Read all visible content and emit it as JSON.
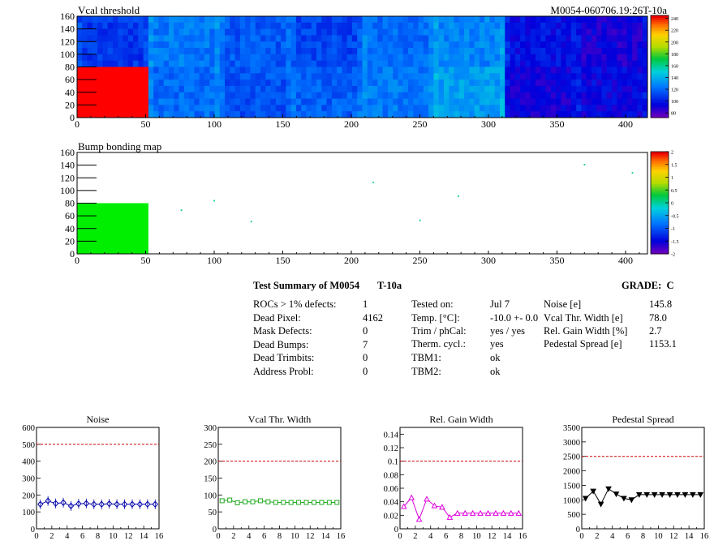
{
  "header": {
    "right_title": "M0054-060706.19:26T-10a"
  },
  "maps": [
    {
      "title": "Vcal threshold",
      "xticks": [
        0,
        50,
        100,
        150,
        200,
        250,
        300,
        350,
        400
      ],
      "yticks": [
        0,
        20,
        40,
        60,
        80,
        100,
        120,
        140,
        160
      ],
      "xlim": [
        0,
        416
      ],
      "ylim": [
        0,
        160
      ],
      "palette_labels": [
        "240",
        "220",
        "200",
        "180",
        "160",
        "140",
        "120",
        "100",
        "80"
      ],
      "palette_min": 72,
      "palette_max": 245,
      "dead_block": {
        "x": [
          0,
          52
        ],
        "y": [
          0,
          80
        ],
        "color": "#ff0000"
      }
    },
    {
      "title": "Bump bonding map",
      "xticks": [
        0,
        50,
        100,
        150,
        200,
        250,
        300,
        350,
        400
      ],
      "yticks": [
        0,
        20,
        40,
        60,
        80,
        100,
        120,
        140,
        160
      ],
      "xlim": [
        0,
        416
      ],
      "ylim": [
        0,
        160
      ],
      "palette_labels": [
        "2",
        "1.5",
        "1",
        "0.5",
        "0",
        "-0.5",
        "-1",
        "-1.5",
        "-2"
      ],
      "palette_min": -2,
      "palette_max": 2,
      "dead_block": {
        "x": [
          0,
          52
        ],
        "y": [
          0,
          80
        ],
        "color": "#00ee00"
      },
      "points": [
        [
          76,
          69
        ],
        [
          100,
          84
        ],
        [
          127,
          51
        ],
        [
          216,
          113
        ],
        [
          250,
          53
        ],
        [
          278,
          91
        ],
        [
          370,
          141
        ],
        [
          405,
          128
        ]
      ]
    }
  ],
  "summary": {
    "title": "Test Summary of M0054",
    "subtitle": "T-10a",
    "grade": "GRADE:  C",
    "col1": [
      [
        "ROCs > 1% defects:",
        "1"
      ],
      [
        "Dead Pixel:",
        "4162"
      ],
      [
        "Mask Defects:",
        "0"
      ],
      [
        "Dead Bumps:",
        "7"
      ],
      [
        "Dead Trimbits:",
        "0"
      ],
      [
        "Address Probl:",
        "0"
      ]
    ],
    "col2": [
      [
        "Tested on:",
        "Jul 7"
      ],
      [
        "Temp. [°C]:",
        "-10.0 +- 0.0"
      ],
      [
        "Trim / phCal:",
        "yes / yes"
      ],
      [
        "Therm. cycl.:",
        "yes"
      ],
      [
        "TBM1:",
        "ok"
      ],
      [
        "TBM2:",
        "ok"
      ]
    ],
    "col3": [
      [
        "Noise [e]",
        "145.8"
      ],
      [
        "Vcal Thr. Width [e]",
        "78.0"
      ],
      [
        "Rel. Gain Width [%]",
        "2.7"
      ],
      [
        "Pedestal Spread [e]",
        "1153.1"
      ]
    ]
  },
  "chart_data": [
    {
      "type": "line",
      "title": "Noise",
      "x": [
        0,
        1,
        2,
        3,
        4,
        5,
        6,
        7,
        8,
        9,
        10,
        11,
        12,
        13,
        14,
        15
      ],
      "values": [
        145,
        165,
        150,
        155,
        135,
        148,
        150,
        145,
        145,
        148,
        145,
        145,
        145,
        145,
        145,
        145
      ],
      "xlim": [
        0,
        16
      ],
      "ylim": [
        0,
        600
      ],
      "yticks": [
        "0",
        "100",
        "200",
        "300",
        "400",
        "500",
        "600"
      ],
      "xticks": [
        "0",
        "2",
        "4",
        "6",
        "8",
        "10",
        "12",
        "14",
        "16"
      ],
      "threshold": 500,
      "color": "#0000aa",
      "marker": "diamond"
    },
    {
      "type": "line",
      "title": "Vcal Thr. Width",
      "x": [
        0,
        1,
        2,
        3,
        4,
        5,
        6,
        7,
        8,
        9,
        10,
        11,
        12,
        13,
        14,
        15
      ],
      "values": [
        83,
        85,
        77,
        80,
        80,
        83,
        80,
        78,
        78,
        78,
        78,
        78,
        78,
        78,
        78,
        78
      ],
      "xlim": [
        0,
        16
      ],
      "ylim": [
        0,
        300
      ],
      "yticks": [
        "0",
        "50",
        "100",
        "150",
        "200",
        "250",
        "300"
      ],
      "xticks": [
        "0",
        "2",
        "4",
        "6",
        "8",
        "10",
        "12",
        "14",
        "16"
      ],
      "threshold": 200,
      "color": "#22aa22",
      "marker": "square"
    },
    {
      "type": "line",
      "title": "Rel. Gain Width",
      "x": [
        0,
        1,
        2,
        3,
        4,
        5,
        6,
        7,
        8,
        9,
        10,
        11,
        12,
        13,
        14,
        15
      ],
      "values": [
        0.033,
        0.046,
        0.014,
        0.044,
        0.034,
        0.032,
        0.017,
        0.023,
        0.023,
        0.023,
        0.023,
        0.023,
        0.023,
        0.023,
        0.023,
        0.023
      ],
      "xlim": [
        0,
        16
      ],
      "ylim": [
        0,
        0.15
      ],
      "yticks": [
        "0",
        "0.02",
        "0.04",
        "0.06",
        "0.08",
        "0.1",
        "0.12",
        "0.14"
      ],
      "ytick_values": [
        0,
        0.02,
        0.04,
        0.06,
        0.08,
        0.1,
        0.12,
        0.14
      ],
      "xticks": [
        "0",
        "2",
        "4",
        "6",
        "8",
        "10",
        "12",
        "14",
        "16"
      ],
      "threshold": 0.1,
      "color": "#dd00dd",
      "marker": "triangle-up"
    },
    {
      "type": "line",
      "title": "Pedestal Spread",
      "x": [
        0,
        1,
        2,
        3,
        4,
        5,
        6,
        7,
        8,
        9,
        10,
        11,
        12,
        13,
        14,
        15
      ],
      "values": [
        1050,
        1300,
        850,
        1380,
        1200,
        1050,
        1000,
        1180,
        1180,
        1180,
        1180,
        1180,
        1180,
        1180,
        1180,
        1180
      ],
      "xlim": [
        0,
        16
      ],
      "ylim": [
        0,
        3500
      ],
      "yticks": [
        "0",
        "500",
        "1000",
        "1500",
        "2000",
        "2500",
        "3000",
        "3500"
      ],
      "xticks": [
        "0",
        "2",
        "4",
        "6",
        "8",
        "10",
        "12",
        "14",
        "16"
      ],
      "threshold": 2500,
      "color": "#000000",
      "marker": "triangle-down"
    }
  ]
}
